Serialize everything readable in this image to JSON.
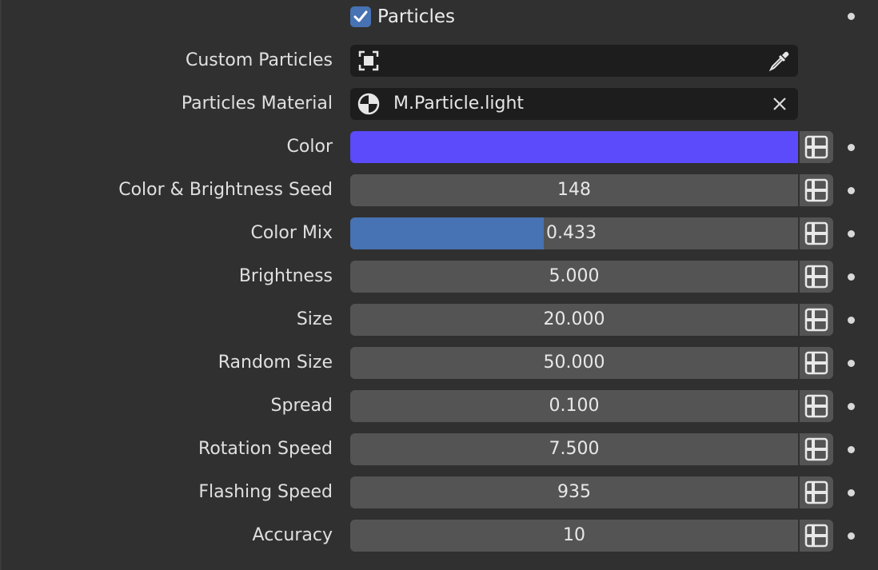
{
  "particles": {
    "label": "Particles",
    "checked": true
  },
  "custom_particles": {
    "label": "Custom Particles",
    "value": ""
  },
  "particles_material": {
    "label": "Particles Material",
    "value": "M.Particle.light"
  },
  "color": {
    "label": "Color",
    "hex": "#5b4bfb"
  },
  "rows": {
    "seed": {
      "label": "Color & Brightness Seed",
      "value": "148"
    },
    "color_mix": {
      "label": "Color Mix",
      "value": "0.433",
      "fraction": 0.433
    },
    "brightness": {
      "label": "Brightness",
      "value": "5.000"
    },
    "size": {
      "label": "Size",
      "value": "20.000"
    },
    "random_size": {
      "label": "Random Size",
      "value": "50.000"
    },
    "spread": {
      "label": "Spread",
      "value": "0.100"
    },
    "rotation_speed": {
      "label": "Rotation Speed",
      "value": "7.500"
    },
    "flashing_speed": {
      "label": "Flashing Speed",
      "value": "935"
    },
    "accuracy": {
      "label": "Accuracy",
      "value": "10"
    }
  },
  "colors": {
    "background": "#303030",
    "field": "#545454",
    "accent": "#4772b3",
    "dark_field": "#1d1d1d"
  }
}
